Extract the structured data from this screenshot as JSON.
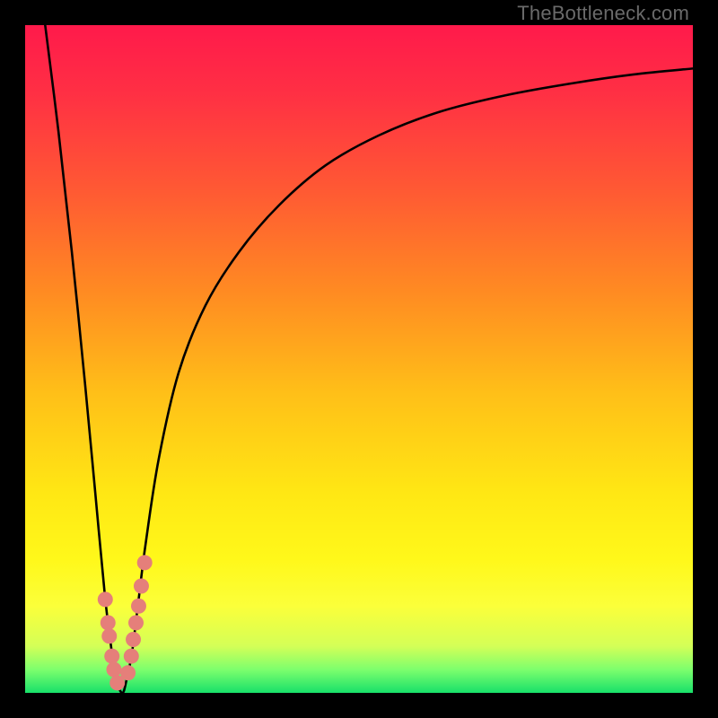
{
  "watermark": {
    "text": "TheBottleneck.com"
  },
  "colors": {
    "frame": "#000000",
    "curve": "#000000",
    "marker_fill": "#e57f7a",
    "marker_stroke": "#d46a64",
    "gradient_stops": [
      {
        "offset": 0.0,
        "color": "#ff1a4b"
      },
      {
        "offset": 0.1,
        "color": "#ff2f44"
      },
      {
        "offset": 0.25,
        "color": "#ff5a33"
      },
      {
        "offset": 0.4,
        "color": "#ff8b22"
      },
      {
        "offset": 0.55,
        "color": "#ffbf18"
      },
      {
        "offset": 0.7,
        "color": "#ffe714"
      },
      {
        "offset": 0.8,
        "color": "#fff81a"
      },
      {
        "offset": 0.87,
        "color": "#fbff3a"
      },
      {
        "offset": 0.93,
        "color": "#d4ff57"
      },
      {
        "offset": 0.965,
        "color": "#7dff6d"
      },
      {
        "offset": 1.0,
        "color": "#18e06a"
      }
    ]
  },
  "chart_data": {
    "type": "line",
    "title": "",
    "xlabel": "",
    "ylabel": "",
    "xlim": [
      0,
      100
    ],
    "ylim": [
      0,
      100
    ],
    "grid": false,
    "legend": false,
    "series": [
      {
        "name": "bottleneck-curve",
        "x": [
          3,
          5,
          7,
          9,
          10.5,
          12,
          13,
          13.8,
          14.6,
          15.2,
          16,
          17,
          18,
          20,
          23,
          27,
          32,
          38,
          45,
          53,
          62,
          72,
          82,
          91,
          100
        ],
        "y": [
          100,
          84,
          66,
          46,
          30,
          14,
          6,
          1.5,
          0,
          2,
          6,
          14,
          22,
          35,
          48,
          58,
          66,
          73,
          79,
          83.5,
          87,
          89.5,
          91.3,
          92.6,
          93.5
        ]
      }
    ],
    "markers": [
      {
        "series": "left-markers",
        "x": [
          12.0,
          12.4,
          12.6,
          13.0,
          13.3,
          13.8
        ],
        "y": [
          14.0,
          10.5,
          8.5,
          5.5,
          3.5,
          1.5
        ]
      },
      {
        "series": "right-markers",
        "x": [
          15.4,
          15.9,
          16.2,
          16.6,
          17.0,
          17.4,
          17.9
        ],
        "y": [
          3.0,
          5.5,
          8.0,
          10.5,
          13.0,
          16.0,
          19.5
        ]
      }
    ]
  }
}
